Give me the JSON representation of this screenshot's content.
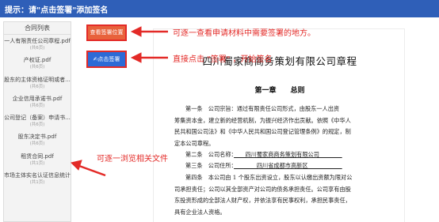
{
  "topbar": {
    "text": "提示：请\"点击签署\"添加签名"
  },
  "sidebar": {
    "header": "合同列表",
    "items": [
      {
        "name": "一人有限责任公司章程.pdf",
        "count": "(共6页)"
      },
      {
        "name": "产权证.pdf",
        "count": "(共6页)"
      },
      {
        "name": "股东的主体资格证明或者...",
        "count": "(共6页)"
      },
      {
        "name": "企业信用承诺书.pdf",
        "count": "(共6页)"
      },
      {
        "name": "公司登记（备案）申请书...",
        "count": "(共6页)"
      },
      {
        "name": "股东决定书.pdf",
        "count": "(共6页)"
      },
      {
        "name": "租赁合同.pdf",
        "count": "(共1页)"
      },
      {
        "name": "市场主体实名认证信息统计表...",
        "count": "(共1页)"
      }
    ]
  },
  "buttons": {
    "view_positions": "查看签署位置",
    "sign": "✍点击签署"
  },
  "annotations": {
    "top": "可逐一查看申请材料中需要签署的地方。",
    "sign_line1": "直接点击 \"签署\" ，开始签名",
    "list": "可逐一浏览相关文件"
  },
  "document": {
    "title": "四川蜀家商商务策划有限公司章程",
    "chapter": "第一章　　总则",
    "art1_l1": "第一条　公司宗旨：通过有限责任公司形式，由股东一人出资",
    "art1_l2": "筹集资本金，建立新的经营机制，为振兴经济作出贡献。依照《中华人",
    "art1_l3": "民共和国公司法》和《中华人民共和国公司登记管理条例》的规定，制",
    "art1_l4": "定本公司章程。",
    "art2_label": "第二条　公司名称：",
    "art2_value": "　　四川蜀家商商务策划有限公司　　　　",
    "art3_label": "第三条　公司住所：",
    "art3_value": "　　　　四川省成都市高新区　　　　　　",
    "art4_l1": "第四条　本公司由 1 个股东出资设立，股东以认缴出资额为限对公",
    "art4_l2": "司承担责任；公司以其全部资产对公司的债务承担责任。公司享有由股",
    "art4_l3": "东投资形成的全部法人财产权，并依法享有民事权利，承担民事责任，",
    "art4_l4": "具有企业法人资格。"
  }
}
